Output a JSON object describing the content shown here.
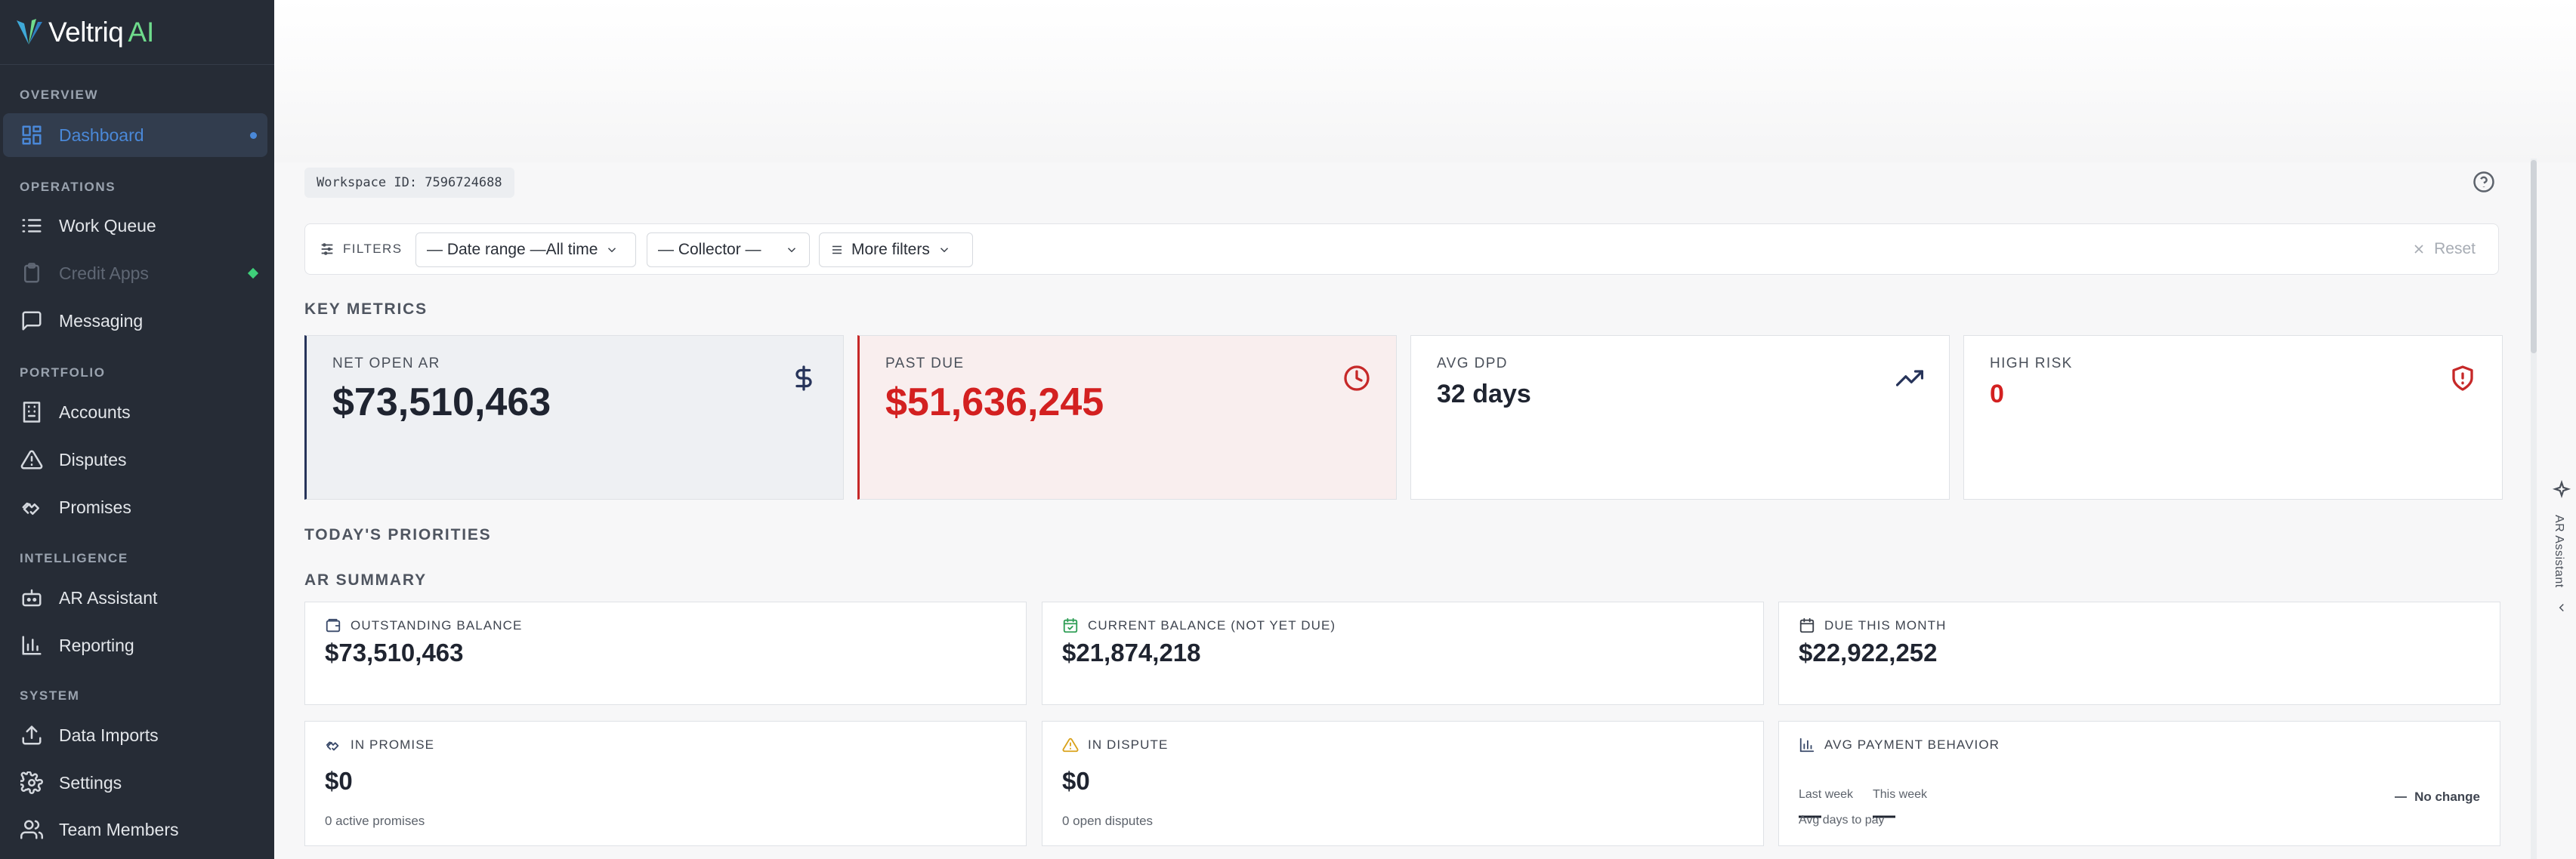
{
  "brand": {
    "name": "Veltriq",
    "suffix": "AI"
  },
  "sidebar": {
    "sections": [
      {
        "label": "OVERVIEW"
      },
      {
        "label": "OPERATIONS"
      },
      {
        "label": "PORTFOLIO"
      },
      {
        "label": "INTELLIGENCE"
      },
      {
        "label": "SYSTEM"
      }
    ],
    "items": [
      {
        "label": "Dashboard",
        "icon": "dashboard-grid-icon"
      },
      {
        "label": "Work Queue",
        "icon": "list-icon"
      },
      {
        "label": "Credit Apps",
        "icon": "clipboard-icon"
      },
      {
        "label": "Messaging",
        "icon": "message-icon"
      },
      {
        "label": "Accounts",
        "icon": "building-icon"
      },
      {
        "label": "Disputes",
        "icon": "warning-triangle-icon"
      },
      {
        "label": "Promises",
        "icon": "handshake-icon"
      },
      {
        "label": "AR Assistant",
        "icon": "bot-icon"
      },
      {
        "label": "Reporting",
        "icon": "bar-chart-icon"
      },
      {
        "label": "Data Imports",
        "icon": "upload-icon"
      },
      {
        "label": "Settings",
        "icon": "gear-icon"
      },
      {
        "label": "Team Members",
        "icon": "users-icon"
      }
    ]
  },
  "workspace": {
    "id_text": "Workspace ID: 7596724688"
  },
  "filters": {
    "label": "FILTERS",
    "date_range": "— Date range —All time",
    "collector": "— Collector —",
    "more": "More filters",
    "reset": "Reset"
  },
  "key_metrics": {
    "title": "KEY METRICS",
    "cards": [
      {
        "label": "NET OPEN AR",
        "value": "$73,510,463",
        "icon": "dollar-icon"
      },
      {
        "label": "PAST DUE",
        "value": "$51,636,245",
        "icon": "clock-icon"
      },
      {
        "label": "AVG DPD",
        "value": "32 days",
        "icon": "trending-up-icon"
      },
      {
        "label": "HIGH RISK",
        "value": "0",
        "icon": "shield-alert-icon"
      }
    ]
  },
  "priorities": {
    "title": "TODAY'S PRIORITIES"
  },
  "ar_summary": {
    "title": "AR SUMMARY",
    "cards": [
      {
        "label": "OUTSTANDING BALANCE",
        "value": "$73,510,463",
        "icon": "wallet-icon"
      },
      {
        "label": "CURRENT BALANCE (NOT YET DUE)",
        "value": "$21,874,218",
        "icon": "calendar-check-icon"
      },
      {
        "label": "DUE THIS MONTH",
        "value": "$22,922,252",
        "icon": "calendar-icon"
      },
      {
        "label": "IN PROMISE",
        "value": "$0",
        "sub": "0 active promises",
        "icon": "handshake-icon"
      },
      {
        "label": "IN DISPUTE",
        "value": "$0",
        "sub": "0 open disputes",
        "icon": "warning-triangle-icon"
      },
      {
        "label": "AVG PAYMENT BEHAVIOR",
        "icon": "bar-chart-icon",
        "last_week_label": "Last week",
        "last_week_value": "—",
        "this_week_label": "This week",
        "this_week_value": "—",
        "sub": "Avg days to pay",
        "change": "No change"
      }
    ]
  },
  "assistant_rail": {
    "label": "AR Assistant"
  },
  "colors": {
    "accent": "#4a88d8",
    "danger": "#d32020",
    "sidebar_bg": "#262c36",
    "brand_green": "#6fdc8c"
  }
}
